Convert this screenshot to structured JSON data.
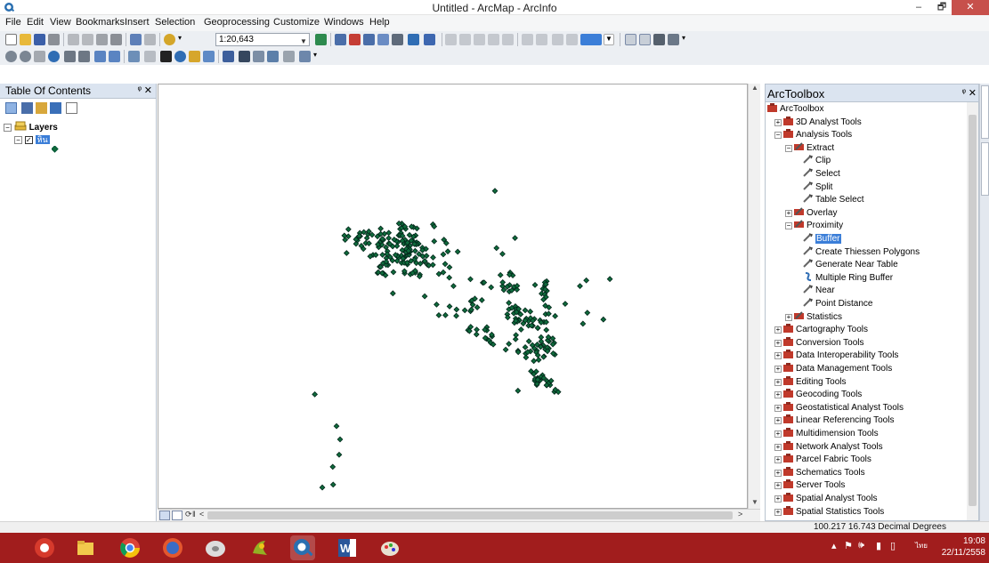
{
  "window": {
    "title": "Untitled - ArcMap - ArcInfo",
    "minimize": "–",
    "maximize": "🗗",
    "close": "✕"
  },
  "menu": [
    "File",
    "Edit",
    "View",
    "Bookmarks",
    "Insert",
    "Selection",
    "Geoprocessing",
    "Customize",
    "Windows",
    "Help"
  ],
  "toolbar": {
    "scale": "1:20,643"
  },
  "toc": {
    "title": "Table Of Contents",
    "pin": "ᵠ",
    "close": "✕",
    "layers_label": "Layers",
    "layer_name": "หิน"
  },
  "toolbox": {
    "title": "ArcToolbox",
    "pin": "ᵠ",
    "close": "✕",
    "items": [
      {
        "label": "ArcToolbox",
        "level": 0,
        "kind": "root"
      },
      {
        "label": "3D Analyst Tools",
        "level": 1,
        "kind": "box",
        "pm": "+"
      },
      {
        "label": "Analysis Tools",
        "level": 1,
        "kind": "box",
        "pm": "−"
      },
      {
        "label": "Extract",
        "level": 2,
        "kind": "set",
        "pm": "−"
      },
      {
        "label": "Clip",
        "level": 3,
        "kind": "tool"
      },
      {
        "label": "Select",
        "level": 3,
        "kind": "tool"
      },
      {
        "label": "Split",
        "level": 3,
        "kind": "tool"
      },
      {
        "label": "Table Select",
        "level": 3,
        "kind": "tool"
      },
      {
        "label": "Overlay",
        "level": 2,
        "kind": "set",
        "pm": "+"
      },
      {
        "label": "Proximity",
        "level": 2,
        "kind": "set",
        "pm": "−"
      },
      {
        "label": "Buffer",
        "level": 3,
        "kind": "tool",
        "selected": true
      },
      {
        "label": "Create Thiessen Polygons",
        "level": 3,
        "kind": "tool"
      },
      {
        "label": "Generate Near Table",
        "level": 3,
        "kind": "tool"
      },
      {
        "label": "Multiple Ring Buffer",
        "level": 3,
        "kind": "script"
      },
      {
        "label": "Near",
        "level": 3,
        "kind": "tool"
      },
      {
        "label": "Point Distance",
        "level": 3,
        "kind": "tool"
      },
      {
        "label": "Statistics",
        "level": 2,
        "kind": "set",
        "pm": "+"
      },
      {
        "label": "Cartography Tools",
        "level": 1,
        "kind": "box",
        "pm": "+"
      },
      {
        "label": "Conversion Tools",
        "level": 1,
        "kind": "box",
        "pm": "+"
      },
      {
        "label": "Data Interoperability Tools",
        "level": 1,
        "kind": "box",
        "pm": "+"
      },
      {
        "label": "Data Management Tools",
        "level": 1,
        "kind": "box",
        "pm": "+"
      },
      {
        "label": "Editing Tools",
        "level": 1,
        "kind": "box",
        "pm": "+"
      },
      {
        "label": "Geocoding Tools",
        "level": 1,
        "kind": "box",
        "pm": "+"
      },
      {
        "label": "Geostatistical Analyst Tools",
        "level": 1,
        "kind": "box",
        "pm": "+"
      },
      {
        "label": "Linear Referencing Tools",
        "level": 1,
        "kind": "box",
        "pm": "+"
      },
      {
        "label": "Multidimension Tools",
        "level": 1,
        "kind": "box",
        "pm": "+"
      },
      {
        "label": "Network Analyst Tools",
        "level": 1,
        "kind": "box",
        "pm": "+"
      },
      {
        "label": "Parcel Fabric Tools",
        "level": 1,
        "kind": "box",
        "pm": "+"
      },
      {
        "label": "Schematics Tools",
        "level": 1,
        "kind": "box",
        "pm": "+"
      },
      {
        "label": "Server Tools",
        "level": 1,
        "kind": "box",
        "pm": "+"
      },
      {
        "label": "Spatial Analyst Tools",
        "level": 1,
        "kind": "box",
        "pm": "+"
      },
      {
        "label": "Spatial Statistics Tools",
        "level": 1,
        "kind": "box",
        "pm": "+"
      }
    ]
  },
  "status": {
    "coords": "100.217  16.743 Decimal Degrees"
  },
  "taskbar": {
    "time": "19:08",
    "date": "22/11/2558",
    "lang": "ไทย",
    "apps": [
      "arcgis-icon",
      "file-explorer-icon",
      "chrome-icon",
      "firefox-like-icon",
      "disk-icon",
      "qgis-icon",
      "arcmap-icon",
      "word-icon",
      "paint-icon"
    ]
  },
  "colors": {
    "taskbar": "#a11d1d",
    "point_fill": "#0f6b3c",
    "selection": "#3b7ed8",
    "panel_header": "#dbe4f0"
  }
}
